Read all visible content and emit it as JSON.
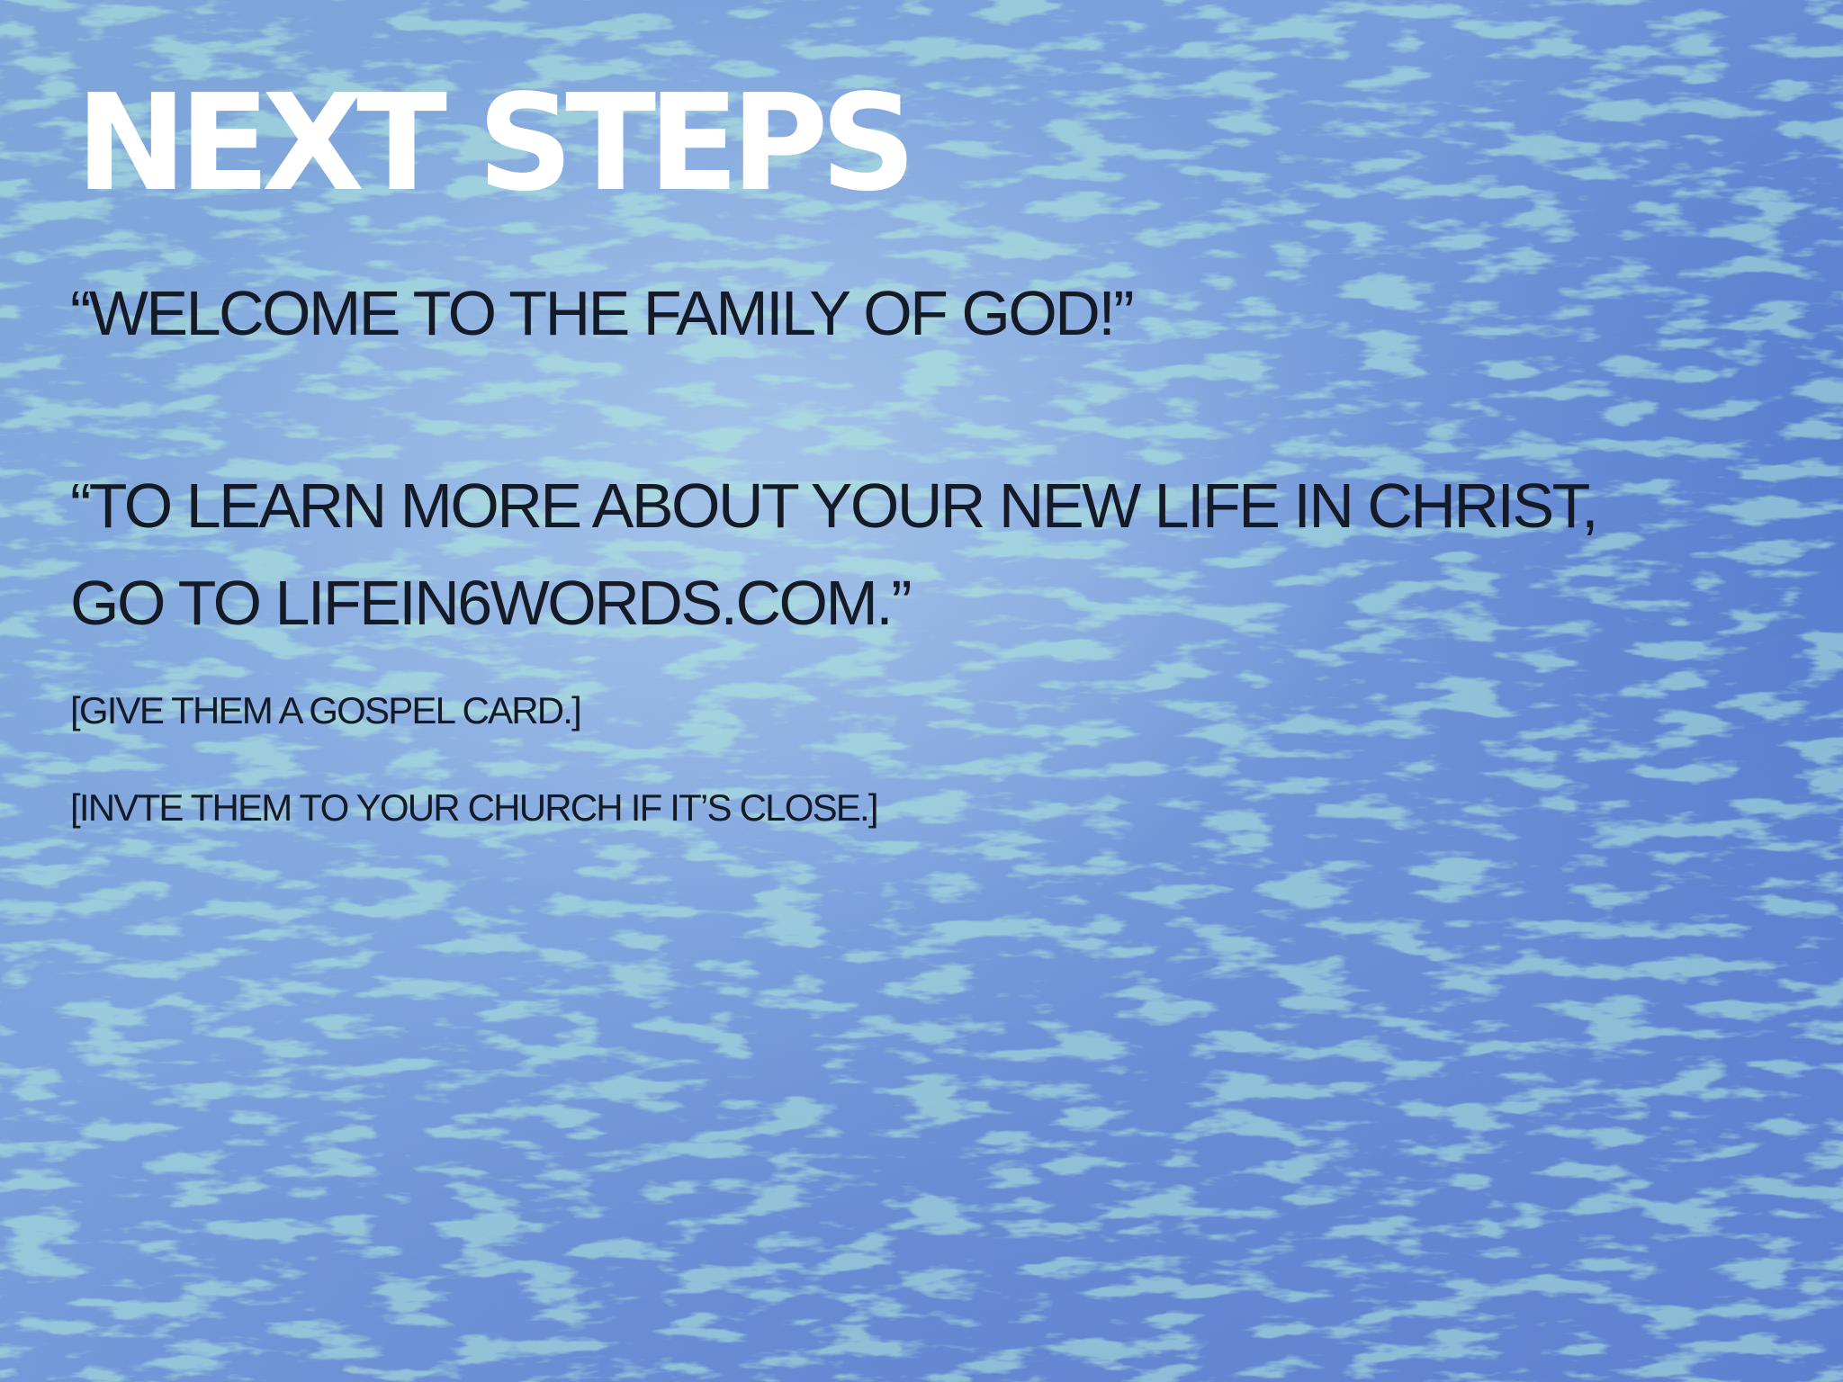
{
  "slide": {
    "title": "NEXT STEPS",
    "lines": [
      "“WELCOME TO THE FAMILY OF GOD!”",
      "“TO LEARN MORE ABOUT YOUR NEW LIFE IN CHRIST,",
      "GO TO LIFEIN6WORDS.COM.”",
      "[GIVE THEM A GOSPEL CARD.]",
      "[INVTE THEM TO YOUR CHURCH IF IT’S CLOSE.]"
    ]
  },
  "colors": {
    "background": "#6f95d4",
    "title": "#ffffff",
    "body_text": "#141a26",
    "texture_accent": "#6fd3b4"
  }
}
